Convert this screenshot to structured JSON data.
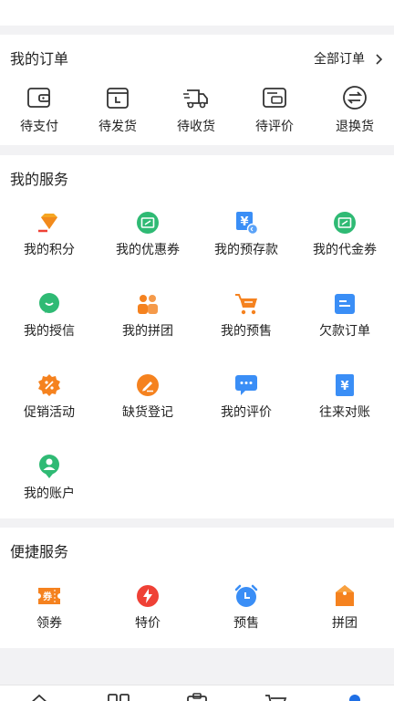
{
  "orders": {
    "title": "我的订单",
    "all_label": "全部订单",
    "items": [
      {
        "label": "待支付",
        "icon": "wallet-icon"
      },
      {
        "label": "待发货",
        "icon": "box-clock-icon"
      },
      {
        "label": "待收货",
        "icon": "truck-icon"
      },
      {
        "label": "待评价",
        "icon": "comment-card-icon"
      },
      {
        "label": "退换货",
        "icon": "exchange-icon"
      }
    ]
  },
  "services": {
    "title": "我的服务",
    "items": [
      {
        "label": "我的积分",
        "icon": "diamond-icon"
      },
      {
        "label": "我的优惠券",
        "icon": "coupon-icon"
      },
      {
        "label": "我的预存款",
        "icon": "deposit-icon"
      },
      {
        "label": "我的代金券",
        "icon": "voucher-icon"
      },
      {
        "label": "我的授信",
        "icon": "credit-chat-icon"
      },
      {
        "label": "我的拼团",
        "icon": "group-icon"
      },
      {
        "label": "我的预售",
        "icon": "cart-icon"
      },
      {
        "label": "欠款订单",
        "icon": "debt-card-icon"
      },
      {
        "label": "促销活动",
        "icon": "promo-badge-icon"
      },
      {
        "label": "缺货登记",
        "icon": "pencil-icon"
      },
      {
        "label": "我的评价",
        "icon": "review-bubble-icon"
      },
      {
        "label": "往来对账",
        "icon": "yuan-doc-icon"
      },
      {
        "label": "我的账户",
        "icon": "account-icon"
      }
    ]
  },
  "convenience": {
    "title": "便捷服务",
    "items": [
      {
        "label": "领券",
        "icon": "ticket-icon",
        "badge": "券"
      },
      {
        "label": "特价",
        "icon": "lightning-icon"
      },
      {
        "label": "预售",
        "icon": "alarm-clock-icon"
      },
      {
        "label": "拼团",
        "icon": "tag-icon"
      }
    ]
  },
  "colors": {
    "accent_blue": "#3a8ef6",
    "green": "#2fba74",
    "orange": "#f5821f",
    "red": "#ef4136"
  }
}
